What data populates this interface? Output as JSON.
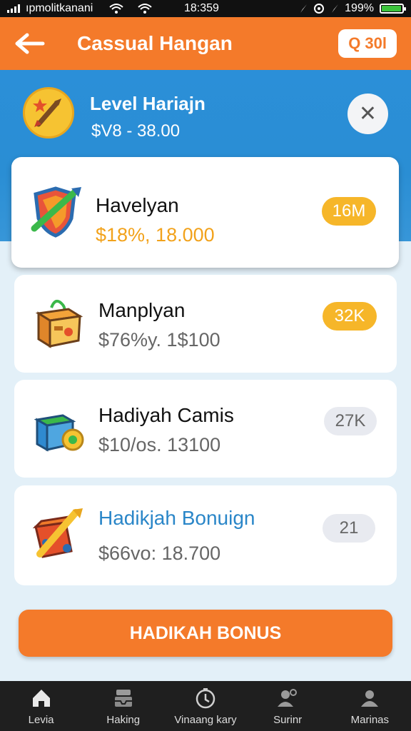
{
  "status_bar": {
    "carrier": "ıpmolitkanani",
    "time": "18:359",
    "battery": "199%"
  },
  "header": {
    "title": "Cassual Hangan",
    "pill_label": "Q 30l"
  },
  "level": {
    "title": "Level Hariajn",
    "range": "$V8 - 38.00"
  },
  "items": [
    {
      "name": "Havelyan",
      "price": "$18%, 18.000",
      "badge": "16M"
    },
    {
      "name": "Manplyan",
      "price": "$76%y. 1$100",
      "badge": "32K"
    },
    {
      "name": "Hadiyah Camis",
      "price": "$10/os. 13100",
      "badge": "27K"
    },
    {
      "name": "Hadikjah Bonuign",
      "price": "$66vo: 18.700",
      "badge": "21"
    }
  ],
  "bonus_button": "HADIKAH BONUS",
  "nav": [
    {
      "label": "Levia",
      "icon": "home-icon"
    },
    {
      "label": "Haking",
      "icon": "inbox-icon"
    },
    {
      "label": "Vinaang kary",
      "icon": "timer-icon"
    },
    {
      "label": "Surinr",
      "icon": "profile-icon"
    },
    {
      "label": "Marinas",
      "icon": "user-icon"
    }
  ],
  "colors": {
    "accent": "#f47a2a",
    "hero_blue": "#2b8fd8",
    "price_highlight": "#f2a21b",
    "name_highlight": "#2a86c8",
    "badge_orange": "#f6b629"
  }
}
